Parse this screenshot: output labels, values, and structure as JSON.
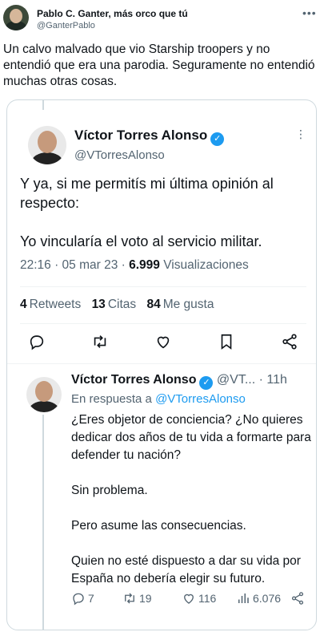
{
  "outer_tweet": {
    "display_name": "Pablo C. Ganter, más orco que tú",
    "handle": "@GanterPablo",
    "text": "Un calvo malvado que vio Starship troopers y no entendió que era una parodia. Seguramente no entendió muchas otras cosas.",
    "more_icon": "more-icon"
  },
  "quoted_tweet": {
    "display_name": "Víctor Torres Alonso",
    "handle": "@VTorresAlonso",
    "text": "Y ya, si me permitís mi última opinión al respecto:\n\nYo vincularía el voto al servicio militar.",
    "time": "22:16 · 05 mar 23 · ",
    "views_count": "6.999",
    "views_label": " Visualizaciones",
    "retweets_count": "4",
    "retweets_label": "Retweets",
    "quotes_count": "13",
    "quotes_label": "Citas",
    "likes_count": "84",
    "likes_label": "Me gusta",
    "verified_icon": "verified-icon"
  },
  "reply": {
    "display_name": "Víctor Torres Alonso",
    "handle_time": "@VT... · 11h",
    "replying_to_prefix": "En respuesta a ",
    "replying_to_handle": "@VTorresAlonso",
    "text": "¿Eres objetor de conciencia? ¿No quieres dedicar dos años de tu vida a formarte para defender tu nación?\n\nSin problema.\n\nPero asume las consecuencias.\n\nQuien no esté dispuesto a dar su vida por España no debería elegir su futuro.",
    "replies": "7",
    "retweets": "19",
    "likes": "116",
    "views": "6.076"
  },
  "colors": {
    "accent": "#1d9bf0",
    "text": "#0f1419",
    "muted": "#536471",
    "border": "#cfd9de"
  }
}
